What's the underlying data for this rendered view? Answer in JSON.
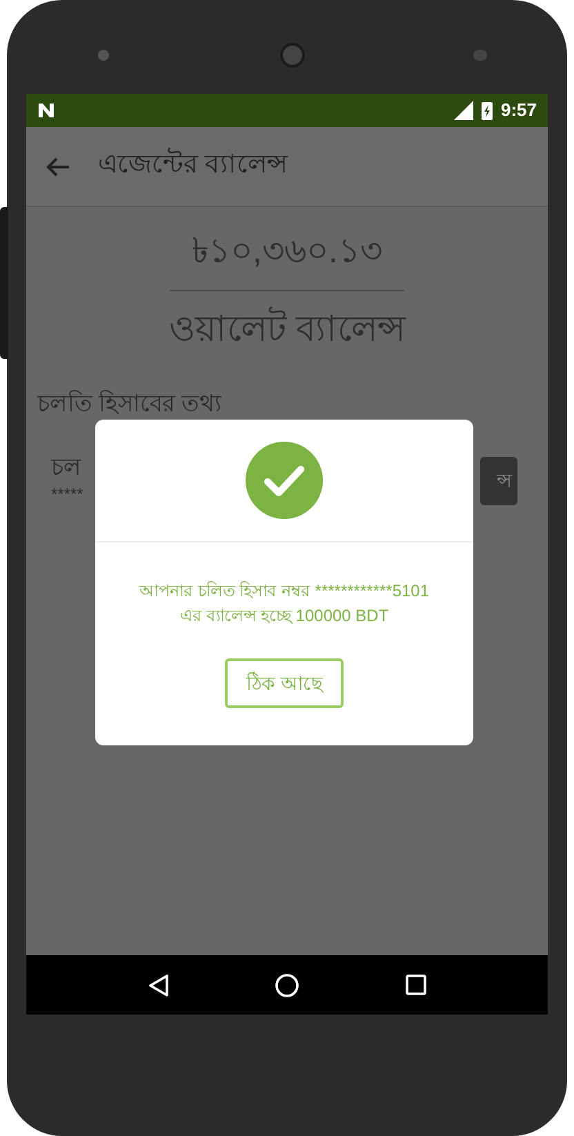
{
  "status_bar": {
    "time": "9:57"
  },
  "app_bar": {
    "title": "এজেন্টের ব্যালেন্স"
  },
  "wallet": {
    "amount": "৳১০,৩৬০.১৩",
    "label": "ওয়ালেট ব্যালেন্স"
  },
  "account_section": {
    "heading": "চলতি হিসাবের তথ্য",
    "row_label": "চল",
    "row_value": "*****",
    "button": "ন্স"
  },
  "dialog": {
    "message": "আপনার চলিত হিসাব নম্বর ************5101 এর ব্যালেন্স হচ্ছে 100000 BDT",
    "button": "ঠিক আছে"
  }
}
